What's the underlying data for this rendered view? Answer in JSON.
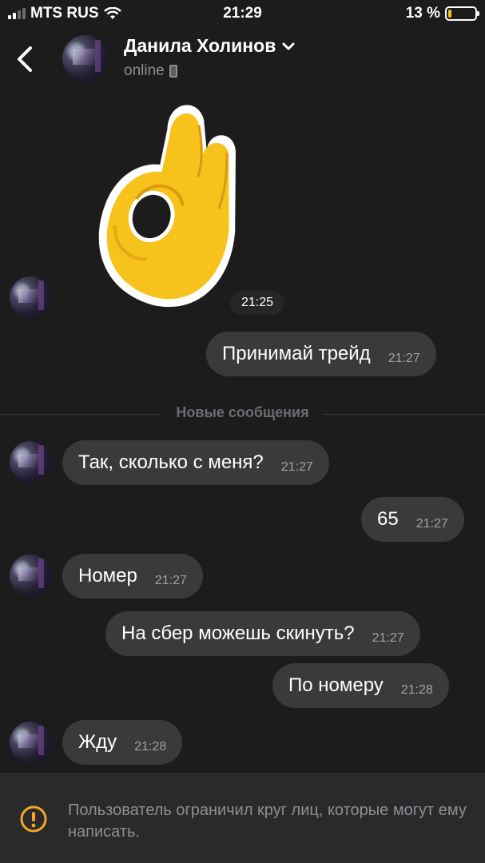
{
  "status_bar": {
    "carrier": "MTS RUS",
    "time": "21:29",
    "battery_percent": "13 %",
    "battery_level": 0.13,
    "signal_bars": 4,
    "signal_bars_on": 2
  },
  "header": {
    "contact_name": "Данила Холинов",
    "status": "online"
  },
  "messages": [
    {
      "type": "sticker",
      "sender": "contact",
      "emoji": "ok-hand",
      "time": "21:25"
    },
    {
      "type": "text",
      "sender": "me",
      "text": "Принимай трейд",
      "time": "21:27"
    },
    {
      "type": "text",
      "sender": "contact",
      "text": "Так, сколько с меня?",
      "time": "21:27"
    },
    {
      "type": "text",
      "sender": "me",
      "text": "65",
      "time": "21:27"
    },
    {
      "type": "text",
      "sender": "contact",
      "text": "Номер",
      "time": "21:27"
    },
    {
      "type": "text",
      "sender": "me",
      "text": "На сбер можешь скинуть?",
      "time": "21:27"
    },
    {
      "type": "text",
      "sender": "me",
      "text": "По номеру",
      "time": "21:28"
    },
    {
      "type": "text",
      "sender": "contact",
      "text": "Жду",
      "time": "21:28"
    }
  ],
  "new_messages_divider": "Новые сообщения",
  "footer": {
    "notice": "Пользователь ограничил круг лиц, которые могут ему написать."
  },
  "colors": {
    "background": "#1c1c1d",
    "bubble": "#3a3a3c",
    "secondary_text": "#8e8e93",
    "sticker_yellow": "#f7c21c",
    "warning_icon": "#f5a623"
  }
}
